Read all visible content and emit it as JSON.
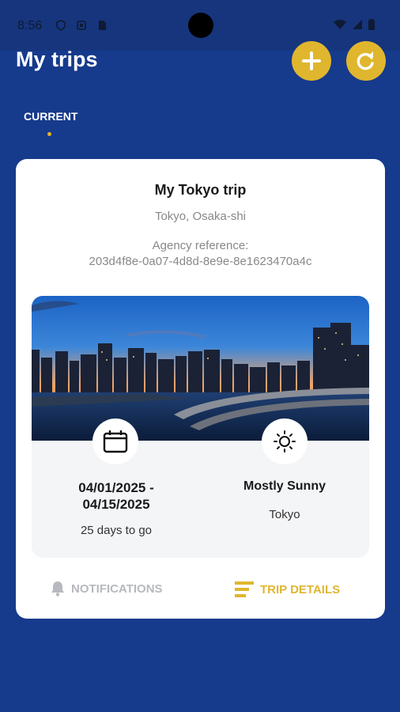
{
  "status_bar": {
    "time": "8:56"
  },
  "header": {
    "title": "My trips"
  },
  "tabs": [
    {
      "label": "CURRENT"
    }
  ],
  "trip": {
    "name": "My Tokyo trip",
    "cities": "Tokyo, Osaka-shi",
    "agency_label": "Agency reference:",
    "agency_ref": "203d4f8e-0a07-4d8d-8e9e-8e1623470a4c",
    "dates": "04/01/2025 -\n04/15/2025",
    "days_to_go": "25 days to go",
    "weather": "Mostly Sunny",
    "weather_city": "Tokyo"
  },
  "actions": {
    "notifications": "NOTIFICATIONS",
    "trip_details": "TRIP DETAILS"
  },
  "colors": {
    "background": "#163a8c",
    "accent": "#e0b62e"
  }
}
